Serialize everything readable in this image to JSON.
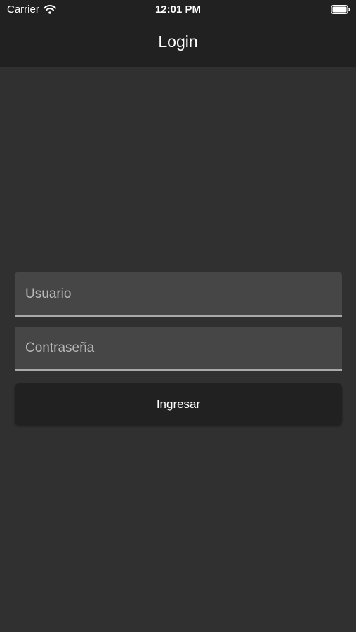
{
  "status_bar": {
    "carrier": "Carrier",
    "time": "12:01 PM"
  },
  "nav": {
    "title": "Login"
  },
  "form": {
    "username": {
      "placeholder": "Usuario",
      "value": ""
    },
    "password": {
      "placeholder": "Contraseña",
      "value": ""
    },
    "submit_label": "Ingresar"
  },
  "colors": {
    "background": "#303030",
    "app_bar": "#212121",
    "field_fill": "#464646",
    "field_underline": "#a9a9a9",
    "button": "#212121",
    "text": "#ffffff"
  },
  "icons": [
    "wifi-icon",
    "battery-icon"
  ]
}
